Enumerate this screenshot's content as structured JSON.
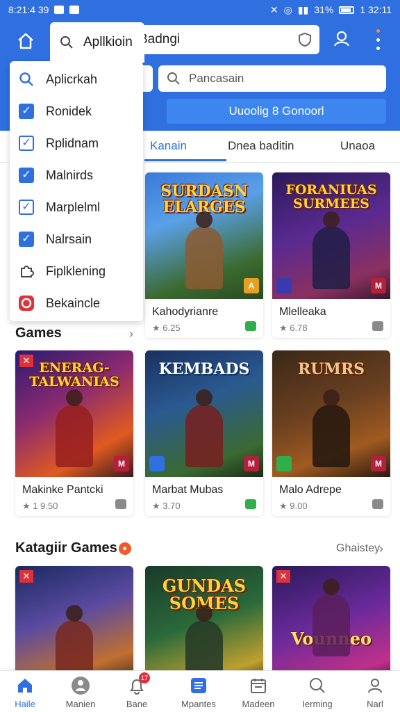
{
  "status_bar": {
    "time_left": "8:21:4 39",
    "time_right": "1 32:11",
    "battery": "31%"
  },
  "header": {
    "search_text": "Apli",
    "search_text_rest": "Badngi",
    "search_overlay_text": "Apllkioin",
    "secondary_search": "Pancasain",
    "banner_button": "Uuoolig 8 Gonoorl"
  },
  "tabs": [
    {
      "label": "Kanain",
      "active": true
    },
    {
      "label": "Dnea baditin",
      "active": false
    },
    {
      "label": "Unaoa",
      "active": false
    }
  ],
  "dropdown": {
    "items": [
      {
        "label": "Aplicrkah",
        "icon": "search-icon",
        "type": "icon"
      },
      {
        "label": "Ronidek",
        "icon": "checkbox",
        "type": "checked"
      },
      {
        "label": "Rplidnam",
        "icon": "checkbox",
        "type": "unchecked"
      },
      {
        "label": "Malnirds",
        "icon": "checkbox",
        "type": "checked"
      },
      {
        "label": "Marplelml",
        "icon": "checkbox",
        "type": "unchecked"
      },
      {
        "label": "Nalrsain",
        "icon": "checkbox",
        "type": "checked"
      },
      {
        "label": "Fiplklening",
        "icon": "puzzle-icon",
        "type": "icon"
      },
      {
        "label": "Bekaincle",
        "icon": "record-icon",
        "type": "icon"
      }
    ]
  },
  "sections": {
    "games_title": "Games",
    "kategori_title": "Katagiir Games",
    "kategori_more": "Ghaistey"
  },
  "cards_row1": [
    {
      "art_title": "SURDASN\nELARGES",
      "name": "Kahodyrianre",
      "rating": "★ 6.25",
      "chip": "green"
    },
    {
      "art_title": "FORANIUAS\nSURMEES",
      "name": "Mlelleaka",
      "rating": "★ 6.78",
      "chip": "gray"
    }
  ],
  "cards_row2": [
    {
      "art_title": "ENERAG-\nTALWANIAS",
      "name": "Makinke Pantcki",
      "rating": "★ 1 9.50",
      "chip": "gray"
    },
    {
      "art_title": "KEMBADS",
      "name": "Marbat Mubas",
      "rating": "★ 3.70",
      "chip": "green"
    },
    {
      "art_title": "RUMRS",
      "name": "Malo Adrepe",
      "rating": "★ 9.00",
      "chip": "gray"
    }
  ],
  "cards_row3": [
    {
      "art_title": ""
    },
    {
      "art_title": "GUNDAS\nSOMES"
    },
    {
      "art_title": "Vounneo"
    }
  ],
  "bottom_nav": [
    {
      "label": "Haile",
      "icon": "home-icon",
      "active": true
    },
    {
      "label": "Manien",
      "icon": "person-icon",
      "active": false
    },
    {
      "label": "Bane",
      "icon": "bell-icon",
      "active": false,
      "badge": "17"
    },
    {
      "label": "Mpantes",
      "icon": "list-icon",
      "active": false
    },
    {
      "label": "Madeen",
      "icon": "calendar-icon",
      "active": false
    },
    {
      "label": "Ierming",
      "icon": "search-icon",
      "active": false
    },
    {
      "label": "Narl",
      "icon": "profile-icon",
      "active": false
    }
  ],
  "colors": {
    "brand": "#2f6fe0",
    "accent": "#ff8a3d",
    "badge_red": "#e0303a"
  }
}
